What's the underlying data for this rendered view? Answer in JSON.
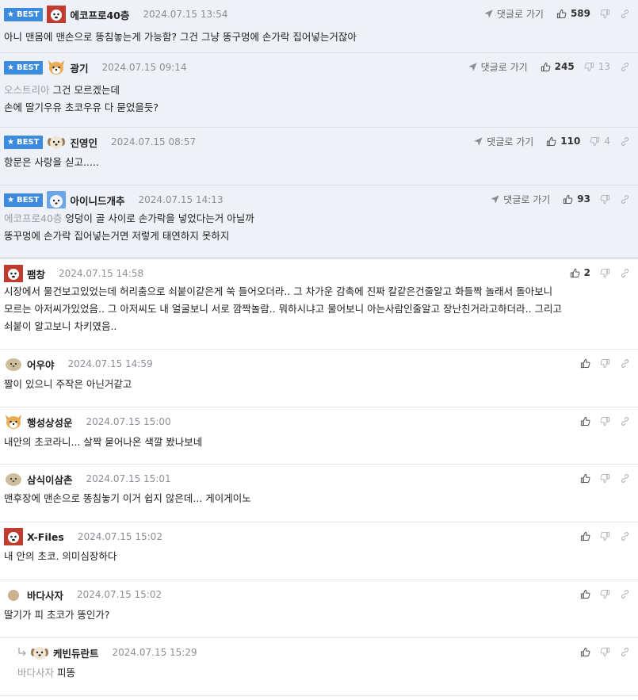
{
  "labels": {
    "best": "BEST",
    "reply_button": "댓글로 가기"
  },
  "colors": {
    "best_badge": "#3c8bdc",
    "best_row": "#eef1f8",
    "date": "#8a8f96",
    "mention": "#9aa0a8"
  },
  "comments": [
    {
      "best": true,
      "avatar": "red-dog-avatar",
      "nick": "에코프로40층",
      "date": "2024.07.15 13:54",
      "reply_button": true,
      "up": "589",
      "down": "",
      "mention": "",
      "lines": [
        "아니 맨몸에 맨손으로 똥침놓는게 가능함? 그건 그냥 똥구멍에 손가락 집어넣는거잖아"
      ]
    },
    {
      "best": true,
      "avatar": "shiba-avatar",
      "nick": "광기",
      "date": "2024.07.15 09:14",
      "reply_button": true,
      "up": "245",
      "down": "13",
      "mention": "오스트리아",
      "lines": [
        "그건 모르겠는데",
        "손에 딸기우유 초코우유 다 묻었을듯?"
      ]
    },
    {
      "best": true,
      "avatar": "puppy-avatar",
      "nick": "진영인",
      "date": "2024.07.15 08:57",
      "reply_button": true,
      "up": "110",
      "down": "4",
      "mention": "",
      "lines": [
        "항문은 사랑을 싣고....."
      ]
    },
    {
      "best": true,
      "avatar": "blue-dog-avatar",
      "nick": "아이니드개추",
      "date": "2024.07.15 14:13",
      "reply_button": true,
      "up": "93",
      "down": "",
      "mention": "에코프로40층",
      "lines": [
        "엉덩이 골 사이로 손가락을 넣었다는거 아닐까",
        "똥꾸멍에 손가락 집어넣는거면 저렇게 태연하지 못하지"
      ]
    },
    {
      "best": false,
      "avatar": "red-dog-avatar",
      "nick": "팸창",
      "date": "2024.07.15 14:58",
      "reply_button": false,
      "up": "2",
      "down": "",
      "mention": "",
      "lines": [
        "시장에서 물건보고있었는데 허리춤으로 쇠붙이같은게 쑥 들어오더라.. 그 차가운 감촉에 진짜 칼같은건줄알고 화들짝 놀래서 돌아보니",
        "모르는 아저씨가있었음.. 그 아저씨도 내 얼굴보니 서로 깜짝놀람.. 뭐하시냐고 물어보니 아는사람인줄알고 장난친거라고하더라.. 그리고",
        "쇠붙이 알고보니 차키였음.."
      ]
    },
    {
      "best": false,
      "avatar": "blob-avatar",
      "nick": "어우야",
      "date": "2024.07.15 14:59",
      "reply_button": false,
      "up": "",
      "down": "",
      "mention": "",
      "lines": [
        "짤이 있으니 주작은 아닌거같고"
      ]
    },
    {
      "best": false,
      "avatar": "shiba-avatar",
      "nick": "행성상성운",
      "date": "2024.07.15 15:00",
      "reply_button": false,
      "up": "",
      "down": "",
      "mention": "",
      "lines": [
        "내안의 초코라니... 살짝 묻어나온 색깔 봤나보네"
      ]
    },
    {
      "best": false,
      "avatar": "blob-avatar",
      "nick": "삼식이삼촌",
      "date": "2024.07.15 15:01",
      "reply_button": false,
      "up": "",
      "down": "",
      "mention": "",
      "lines": [
        "맨후장에 맨손으로 똥침놓기 이거 쉽지 않은데... 게이게이노"
      ]
    },
    {
      "best": false,
      "avatar": "red-dog-avatar",
      "nick": "X-Files",
      "date": "2024.07.15 15:02",
      "reply_button": false,
      "up": "",
      "down": "",
      "mention": "",
      "lines": [
        "내 안의 초코. 의미심장하다"
      ]
    },
    {
      "best": false,
      "avatar": "dot-avatar",
      "nick": "바다사자",
      "date": "2024.07.15 15:02",
      "reply_button": false,
      "up": "",
      "down": "",
      "mention": "",
      "lines": [
        "딸기가 피 초코가 똥인가?"
      ]
    },
    {
      "best": false,
      "reply": true,
      "avatar": "puppy-avatar",
      "nick": "케빈듀란트",
      "date": "2024.07.15 15:29",
      "reply_button": false,
      "up": "",
      "down": "",
      "mention": "바다사자",
      "lines": [
        "피똥"
      ]
    }
  ]
}
